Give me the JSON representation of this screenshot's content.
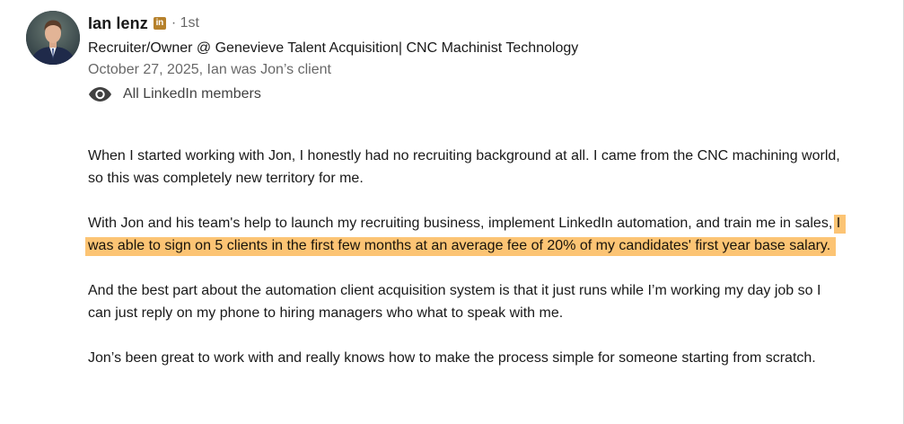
{
  "recommendation": {
    "author": {
      "name": "Ian lenz",
      "degree": "· 1st",
      "headline": "Recruiter/Owner @ Genevieve Talent Acquisition| CNC Machinist Technology"
    },
    "meta": "October 27, 2025, Ian was Jon’s client",
    "visibility": {
      "icon": "eye-icon",
      "label": "All LinkedIn members"
    },
    "badge": {
      "icon": "linkedin-premium-icon",
      "text": "in",
      "color": "#b6812b"
    },
    "paragraphs": {
      "p1": "When I started working with Jon, I honestly had no recruiting background at all. I came from the CNC machining world, so this was completely new territory for me.",
      "p2_before": "With Jon and his team's help to launch my recruiting business, implement LinkedIn automation, and train me in sales,",
      "p2_highlight": "I was able to sign on 5 clients in the first few months at an average fee of 20% of my candidates' first year base salary.",
      "p3": "And the best part about the automation client acquisition system is that it just runs while I’m working my day job so I can just reply on my phone to hiring managers who what to speak with me.",
      "p4": "Jon’s been great to work with and really knows how to make the process simple for someone starting from scratch."
    },
    "highlight_color": "#fcc474"
  }
}
